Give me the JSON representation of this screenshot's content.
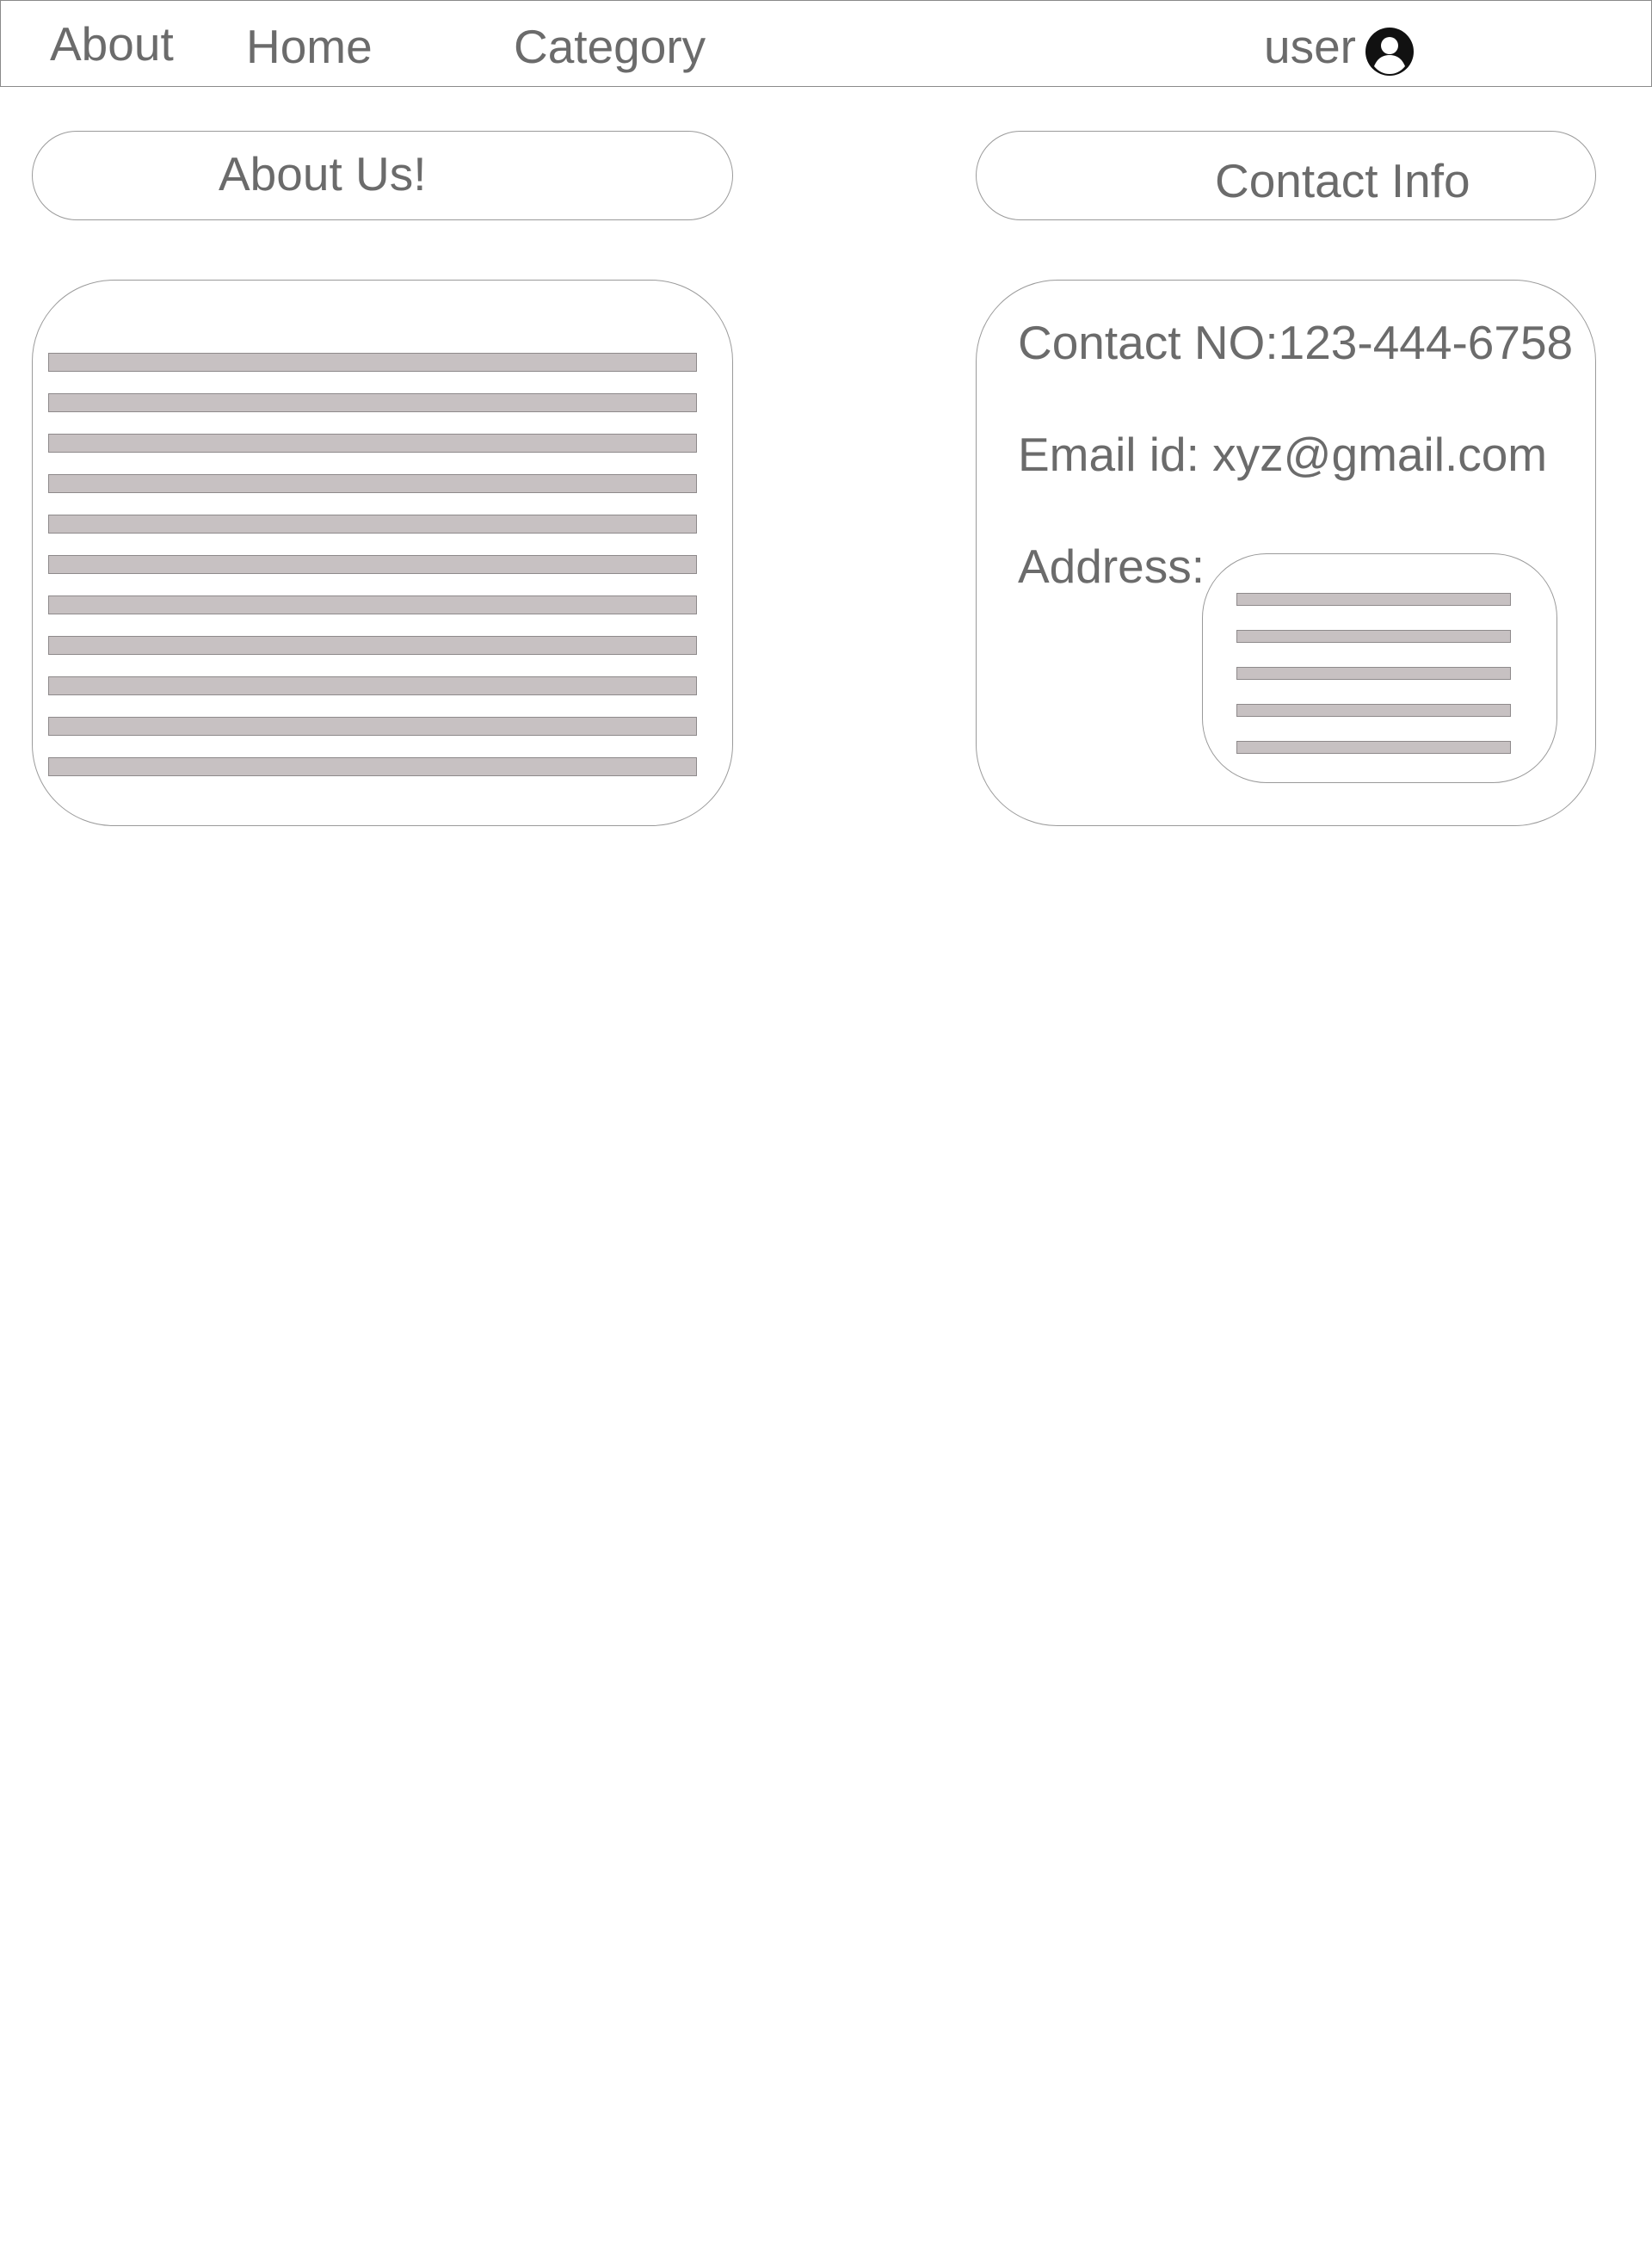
{
  "nav": {
    "about": "About",
    "home": "Home",
    "category": "Category",
    "user": "user",
    "user_icon": "user-circle-icon"
  },
  "about_section": {
    "title": "About Us!",
    "placeholder_lines": 11
  },
  "contact_section": {
    "title": "Contact Info",
    "phone": "Contact NO:123-444-6758",
    "email": "Email id: xyz@gmail.com",
    "address_label": "Address:",
    "address_placeholder_lines": 5
  },
  "colors": {
    "text": "#6b6b6b",
    "border": "#9a9a9a",
    "placeholder_fill": "#c7c1c2",
    "placeholder_border": "#8e8a8b"
  }
}
